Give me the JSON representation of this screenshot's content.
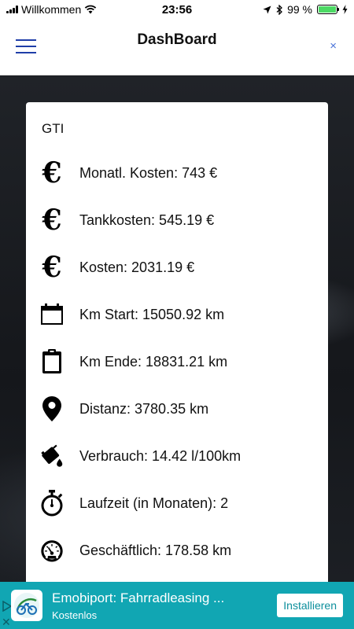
{
  "status_bar": {
    "carrier": "Willkommen",
    "time": "23:56",
    "battery_label": "99 %",
    "battery_level": 0.99
  },
  "header": {
    "title": "DashBoard",
    "close_label": "×"
  },
  "card": {
    "title": "GTI",
    "rows": [
      {
        "icon": "euro-icon",
        "text": "Monatl. Kosten: 743 €"
      },
      {
        "icon": "euro-icon",
        "text": "Tankkosten: 545.19 €"
      },
      {
        "icon": "euro-icon",
        "text": "Kosten: 2031.19 €"
      },
      {
        "icon": "calendar-icon",
        "text": "Km Start: 15050.92 km"
      },
      {
        "icon": "clipboard-icon",
        "text": "Km Ende: 18831.21 km"
      },
      {
        "icon": "map-pin-icon",
        "text": "Distanz: 3780.35 km"
      },
      {
        "icon": "fuel-can-icon",
        "text": "Verbrauch: 14.42 l/100km"
      },
      {
        "icon": "stopwatch-icon",
        "text": "Laufzeit (in Monaten): 2"
      },
      {
        "icon": "speedometer-icon",
        "text": "Geschäftlich: 178.58 km"
      }
    ]
  },
  "euro_glyph": "€",
  "ad": {
    "title": "Emobiport: Fahrradleasing ...",
    "subtitle": "Kostenlos",
    "install_label": "Installieren",
    "close_label": "✕",
    "color": "#11a6b3"
  }
}
